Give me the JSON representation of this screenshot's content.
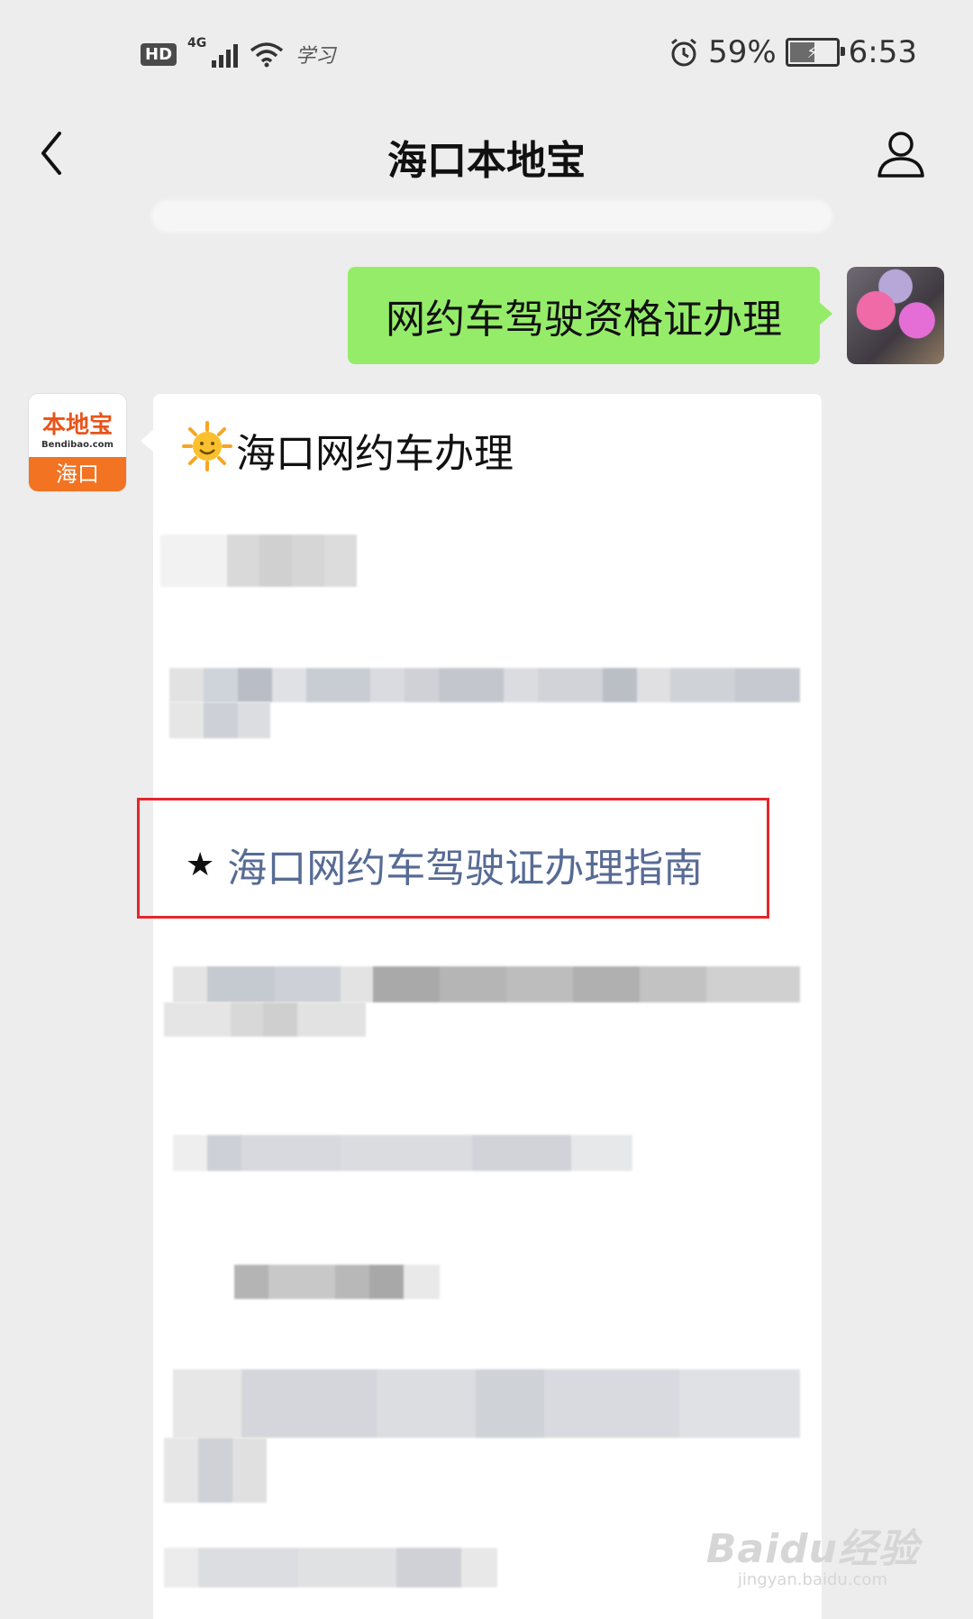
{
  "status_bar": {
    "hd": "HD",
    "network": "4G",
    "carrier_label": "学习",
    "battery_percent": "59%",
    "battery_level": 0.59,
    "time": "6:53"
  },
  "header": {
    "title": "海口本地宝",
    "back_icon": "chevron-left-icon",
    "profile_icon": "person-icon"
  },
  "chat": {
    "user_message": "网约车驾驶资格证办理",
    "bot": {
      "avatar_brand": "本地宝",
      "avatar_url": "Bendibao.com",
      "avatar_city": "海口",
      "heading": "海口网约车办理",
      "heading_icon": "sun-emoji-icon",
      "guide_link": "海口网约车驾驶证办理指南",
      "guide_icon": "star-icon"
    }
  },
  "watermark": {
    "main": "Baidu经验",
    "sub": "jingyan.baidu.com"
  },
  "colors": {
    "background": "#ededed",
    "user_bubble": "#95ec69",
    "bot_bubble": "#ffffff",
    "link": "#576b95",
    "highlight": "#e4262b"
  }
}
